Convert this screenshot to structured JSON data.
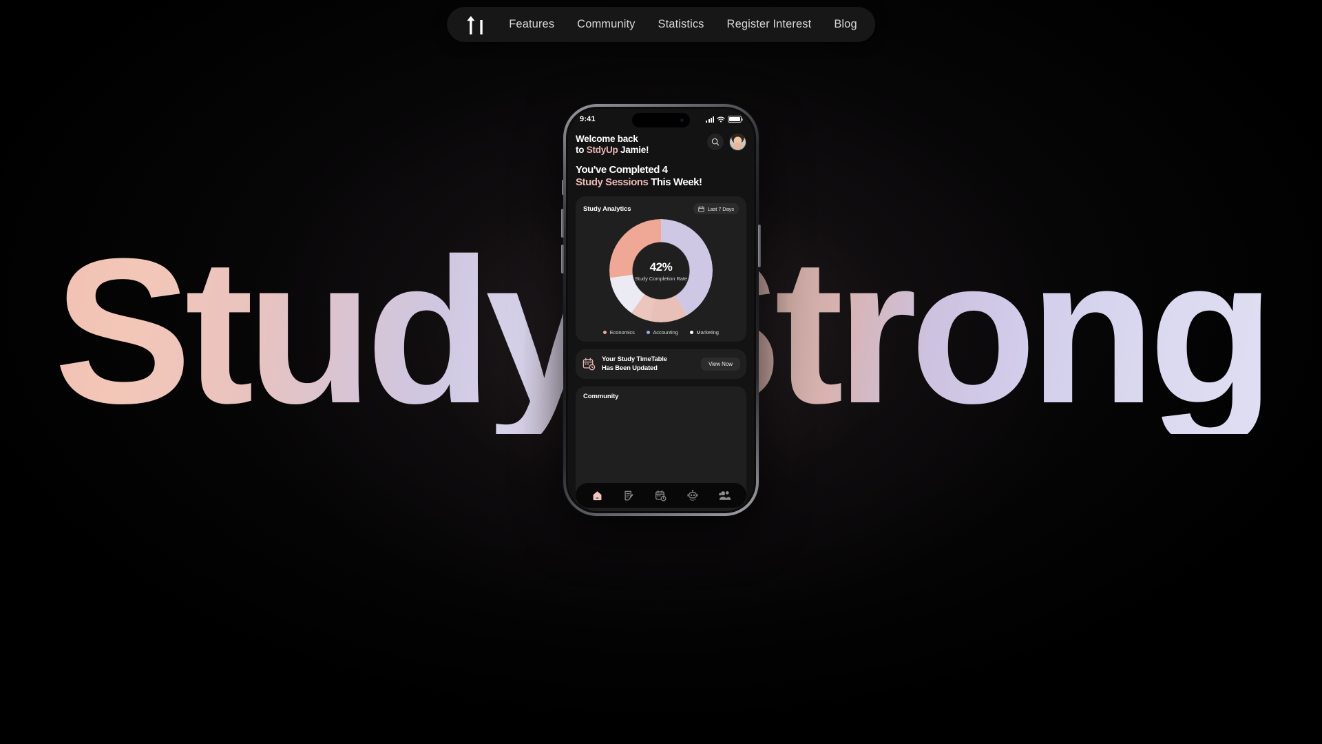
{
  "hero": {
    "word": "Study Strong"
  },
  "nav": {
    "logo_icon": "uturn-arrow-logo",
    "links": [
      {
        "label": "Features"
      },
      {
        "label": "Community"
      },
      {
        "label": "Statistics"
      },
      {
        "label": "Register Interest"
      },
      {
        "label": "Blog"
      }
    ]
  },
  "phone": {
    "status": {
      "time": "9:41",
      "signal_icon": "cellular-signal-icon",
      "wifi_icon": "wifi-icon",
      "battery_icon": "battery-icon"
    },
    "header": {
      "welcome_line1": "Welcome back",
      "welcome_prefix": "to ",
      "brand": "StdyUp",
      "welcome_suffix": " Jamie!",
      "search_icon": "search-icon",
      "avatar": "user-avatar"
    },
    "headline": {
      "line1": "You've Completed 4",
      "line2_accent": "Study Sessions",
      "line2_rest": " This Week!"
    },
    "analytics": {
      "title": "Study Analytics",
      "range_chip": "Last 7 Days",
      "range_icon": "calendar-icon",
      "center_value": "42%",
      "center_label": "Study Completion Rate"
    },
    "timetable": {
      "icon": "calendar-clock-icon",
      "line1": "Your Study TimeTable",
      "line2": "Has Been Updated",
      "button": "View Now"
    },
    "community": {
      "title": "Community"
    },
    "tabs": [
      {
        "name": "home-icon",
        "active": true
      },
      {
        "name": "notes-edit-icon",
        "active": false
      },
      {
        "name": "calendar-clock-icon",
        "active": false
      },
      {
        "name": "chat-bot-icon",
        "active": false
      },
      {
        "name": "people-group-icon",
        "active": false
      }
    ]
  },
  "chart_data": {
    "type": "pie",
    "title": "Study Analytics",
    "subtitle": "Study Completion Rate",
    "center_value": 42,
    "center_value_label": "42%",
    "legend_position": "bottom",
    "categories": [
      "Accounting",
      "Economics",
      "Marketing"
    ],
    "segments": [
      {
        "label": "Accounting",
        "color": "#cfc8e4",
        "start_deg": 0,
        "end_deg": 150,
        "percent": 41.7
      },
      {
        "label": "Economics",
        "color": "#e8c0b8",
        "start_deg": 150,
        "end_deg": 215,
        "percent": 18.1
      },
      {
        "label": "Marketing",
        "color": "#eceaf2",
        "start_deg": 215,
        "end_deg": 262,
        "percent": 13.1
      },
      {
        "label": "Economics",
        "color": "#f0a896",
        "start_deg": 262,
        "end_deg": 360,
        "percent": 27.2
      }
    ],
    "legend": [
      {
        "label": "Economics",
        "color": "#f0a896"
      },
      {
        "label": "Accounting",
        "color": "#a3a6e8"
      },
      {
        "label": "Marketing",
        "color": "#ffffff"
      }
    ]
  },
  "colors": {
    "page_bg": "#000000",
    "nav_bg": "#171717",
    "card_bg": "#1f1f1f",
    "screen_bg": "#131313",
    "accent_pink": "#e9b8b4",
    "accent_salmon": "#f0a896",
    "accent_lavender": "#cfc8e4"
  }
}
